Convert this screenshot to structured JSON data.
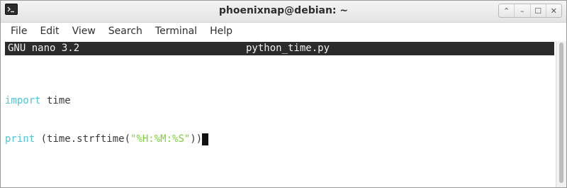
{
  "window": {
    "title": "phoenixnap@debian: ~",
    "controls": {
      "up": "⌃",
      "minimize": "–",
      "maximize": "☐",
      "close": "✕"
    }
  },
  "menu": {
    "items": [
      "File",
      "Edit",
      "View",
      "Search",
      "Terminal",
      "Help"
    ]
  },
  "nano": {
    "version": "GNU nano 3.2",
    "filename": "python_time.py"
  },
  "code": {
    "line1": {
      "keyword": "import",
      "rest": " time"
    },
    "line2": {
      "keyword": "print",
      "before": " (time.strftime(",
      "string": "\"%H:%M:%S\"",
      "after": "))"
    }
  },
  "colors": {
    "keyword": "#4dc5d6",
    "string": "#7dd23a",
    "nano_header_bg": "#2b2b2b"
  }
}
